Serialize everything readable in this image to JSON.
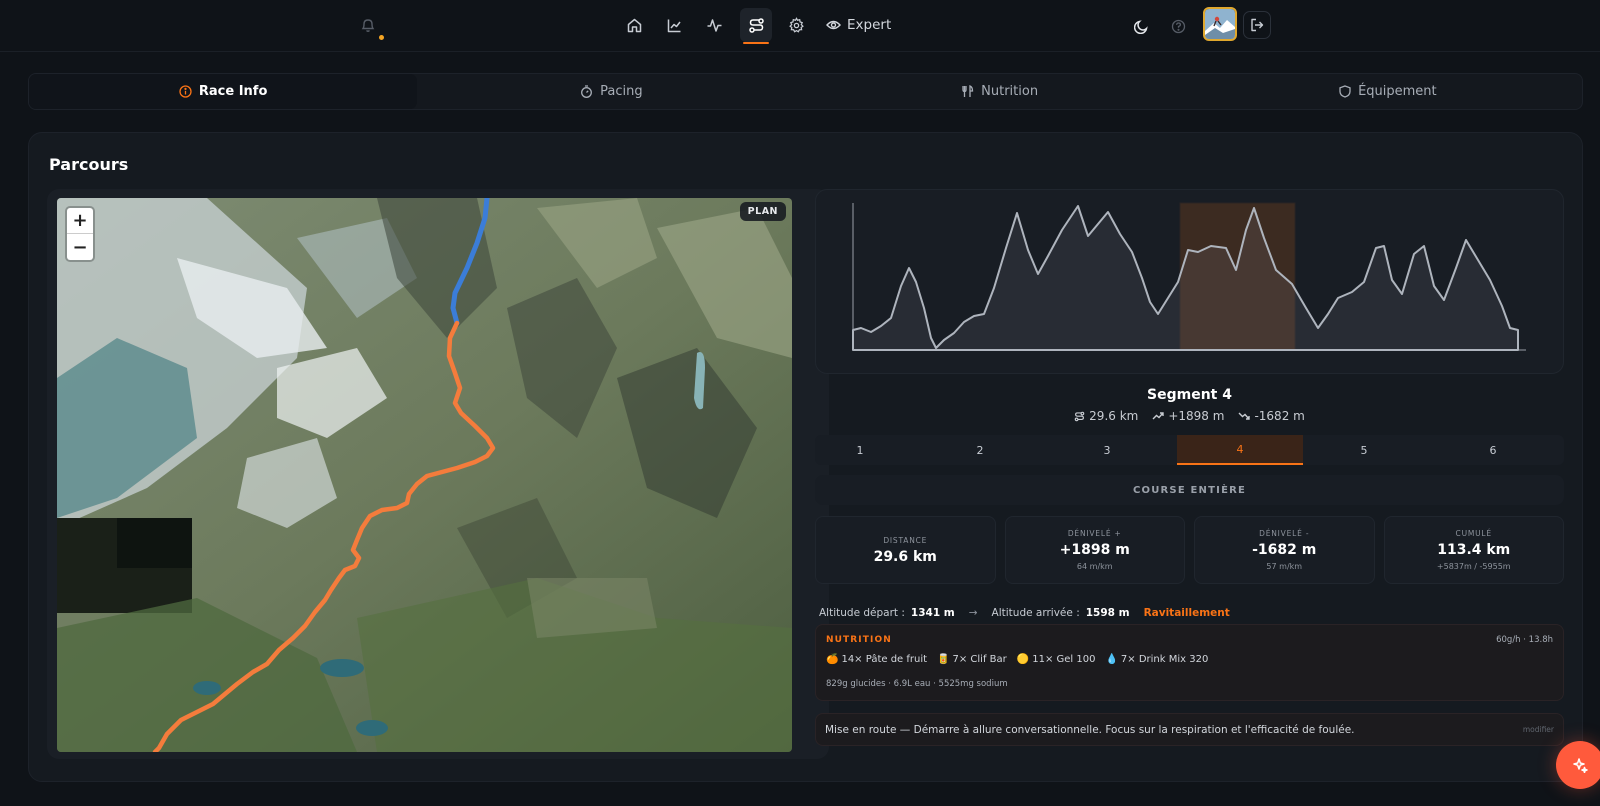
{
  "nav": {
    "icons": [
      "bell-icon",
      "home-icon",
      "chart-icon",
      "activity-icon",
      "route-icon",
      "gear-icon",
      "eye-icon",
      "moon-icon",
      "help-icon",
      "logout-icon"
    ],
    "expert_label": "Expert",
    "accent": "#f97316"
  },
  "tabs": [
    {
      "label": "Race Info",
      "icon": "info-icon",
      "active": true
    },
    {
      "label": "Pacing",
      "icon": "stopwatch-icon",
      "active": false
    },
    {
      "label": "Nutrition",
      "icon": "utensils-icon",
      "active": false
    },
    {
      "label": "Équipement",
      "icon": "shield-icon",
      "active": false
    }
  ],
  "panel": {
    "title": "Parcours",
    "map": {
      "zoom_in": "+",
      "zoom_out": "−",
      "badge": "PLAN"
    },
    "segment": {
      "title": "Segment 4",
      "distance": "29.6 km",
      "gain": "+1898 m",
      "loss": "-1682 m"
    },
    "segment_tabs": [
      "1",
      "2",
      "3",
      "4",
      "5",
      "6"
    ],
    "active_segment": 4,
    "whole_race_label": "COURSE ENTIÈRE",
    "cards": [
      {
        "label": "DISTANCE",
        "value": "29.6 km",
        "sub": ""
      },
      {
        "label": "DÉNIVELÉ +",
        "value": "+1898 m",
        "sub": "64 m/km"
      },
      {
        "label": "DÉNIVELÉ -",
        "value": "-1682 m",
        "sub": "57 m/km"
      },
      {
        "label": "CUMULÉ",
        "value": "113.4 km",
        "sub": "+5837m / -5955m"
      }
    ],
    "altitude": {
      "start_label": "Altitude départ :",
      "start_value": "1341 m",
      "arrow": "→",
      "end_label": "Altitude arrivée :",
      "end_value": "1598 m",
      "aid_label": "Ravitaillement"
    },
    "nutrition": {
      "title": "NUTRITION",
      "rate": "60g/h · 13.8h",
      "items": [
        {
          "icon": "🍊",
          "text": "14× Pâte de fruit"
        },
        {
          "icon": "🥫",
          "text": "7× Clif Bar"
        },
        {
          "icon": "🟡",
          "text": "11× Gel 100"
        },
        {
          "icon": "💧",
          "text": "7× Drink Mix 320"
        }
      ],
      "footer": "829g glucides · 6.9L eau · 5525mg sodium"
    },
    "note": {
      "text": "Mise en route — Démarre à allure conversationnelle. Focus sur la respiration et l'efficacité de foulée.",
      "edit_label": "modifier"
    }
  }
}
